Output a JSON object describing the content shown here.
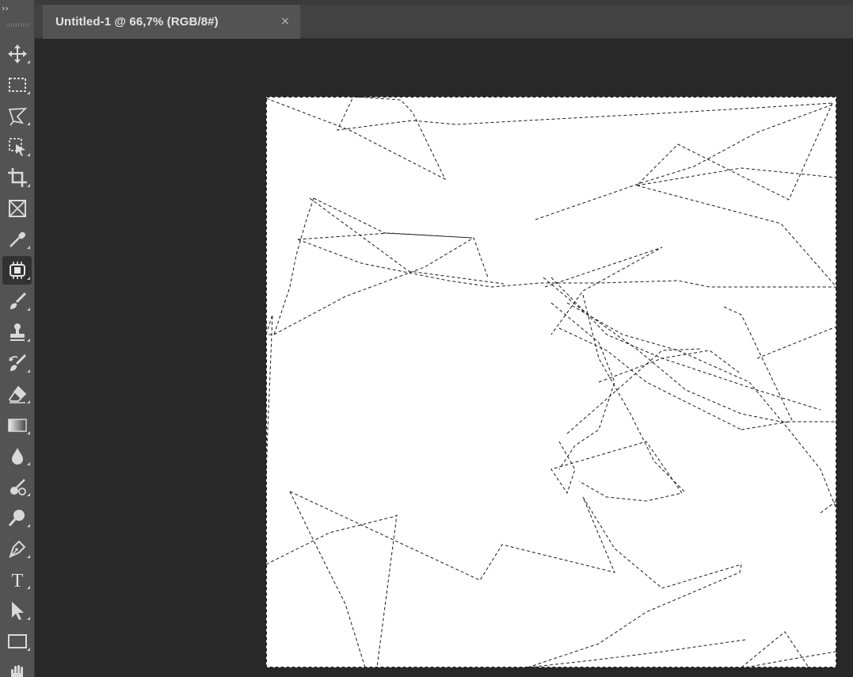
{
  "toolbar": {
    "collapse_glyph": "››",
    "tools": [
      {
        "name": "move-tool",
        "icon": "move-icon",
        "active": false
      },
      {
        "name": "rectangular-marquee-tool",
        "icon": "marquee-icon",
        "active": false
      },
      {
        "name": "polygonal-lasso-tool",
        "icon": "lasso-icon",
        "active": false
      },
      {
        "name": "object-selection-tool",
        "icon": "object-selection-icon",
        "active": false
      },
      {
        "name": "crop-tool",
        "icon": "crop-icon",
        "active": false
      },
      {
        "name": "frame-tool",
        "icon": "frame-icon",
        "active": false
      },
      {
        "name": "eyedropper-tool",
        "icon": "eyedropper-icon",
        "active": false
      },
      {
        "name": "healing-brush-tool",
        "icon": "bandage-icon",
        "active": true
      },
      {
        "name": "brush-tool",
        "icon": "brush-icon",
        "active": false
      },
      {
        "name": "clone-stamp-tool",
        "icon": "stamp-icon",
        "active": false
      },
      {
        "name": "history-brush-tool",
        "icon": "history-brush-icon",
        "active": false
      },
      {
        "name": "eraser-tool",
        "icon": "eraser-icon",
        "active": false
      },
      {
        "name": "gradient-tool",
        "icon": "gradient-icon",
        "active": false
      },
      {
        "name": "blur-tool",
        "icon": "drop-icon",
        "active": false
      },
      {
        "name": "dodge-tool",
        "icon": "dodge-icon",
        "active": false
      },
      {
        "name": "zoom-tool",
        "icon": "magnifier-icon",
        "active": false
      },
      {
        "name": "pen-tool",
        "icon": "pen-icon",
        "active": false
      },
      {
        "name": "type-tool",
        "icon": "type-icon",
        "active": false
      },
      {
        "name": "path-selection-tool",
        "icon": "arrow-pointer-icon",
        "active": false
      },
      {
        "name": "rectangle-tool",
        "icon": "rectangle-icon",
        "active": false
      },
      {
        "name": "hand-tool",
        "icon": "hand-icon",
        "active": false
      }
    ],
    "type_tool_glyph": "T"
  },
  "document": {
    "tab_title": "Untitled-1 @ 66,7% (RGB/8#)",
    "close_glyph": "×",
    "zoom": "66,7%",
    "color_mode": "RGB/8#"
  },
  "colors": {
    "panel": "#535353",
    "workspace": "#282828",
    "canvas": "#ffffff",
    "selection_stroke": "#1a1a1a"
  }
}
